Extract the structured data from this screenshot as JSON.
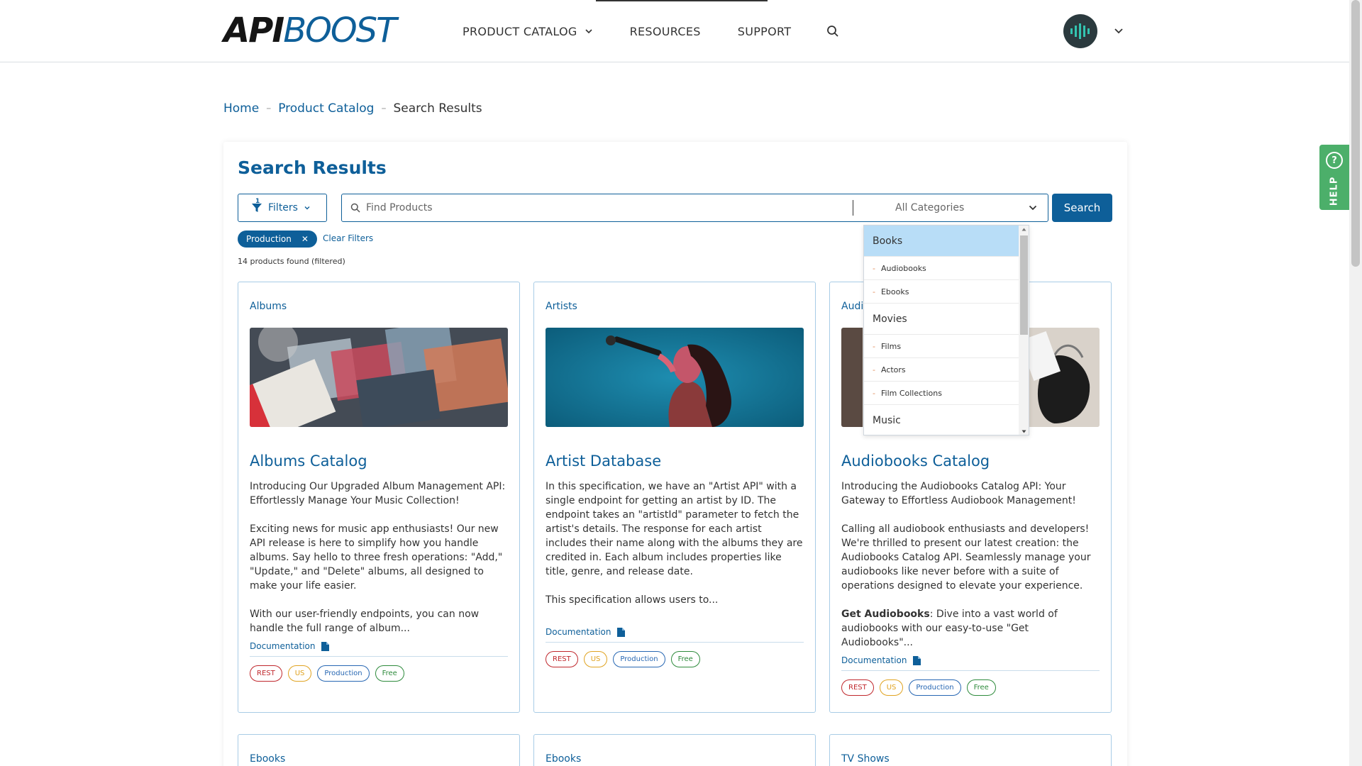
{
  "header": {
    "logo_part1": "API",
    "logo_part2": "BOOST",
    "nav": [
      {
        "label": "PRODUCT CATALOG"
      },
      {
        "label": "RESOURCES"
      },
      {
        "label": "SUPPORT"
      }
    ]
  },
  "help": {
    "label": "HELP",
    "icon": "?"
  },
  "breadcrumb": {
    "home": "Home",
    "catalog": "Product Catalog",
    "current": "Search Results"
  },
  "search": {
    "title": "Search Results",
    "filters_label": "Filters",
    "filter_count": "1",
    "placeholder": "Find Products",
    "category_selected": "All Categories",
    "button": "Search",
    "active_filter": "Production",
    "clear_filters": "Clear Filters",
    "results_text": "14 products found (filtered)"
  },
  "dropdown": {
    "books": "Books",
    "audiobooks": "Audiobooks",
    "ebooks": "Ebooks",
    "movies": "Movies",
    "films": "Films",
    "actors": "Actors",
    "film_collections": "Film Collections",
    "music": "Music",
    "dash": "-"
  },
  "cards": [
    {
      "category": "Albums",
      "title": "Albums Catalog",
      "p1": "Introducing Our Upgraded Album Management API: Effortlessly Manage Your Music Collection!",
      "p2": "Exciting news for music app enthusiasts! Our new API release is here to simplify how you handle albums. Say hello to three fresh operations: \"Add,\" \"Update,\" and \"Delete\" albums, all designed to make your life easier.",
      "p3": "With our user-friendly endpoints, you can now handle the full range of album...",
      "doc": "Documentation",
      "tags": [
        "REST",
        "US",
        "Production",
        "Free"
      ]
    },
    {
      "category": "Artists",
      "title": "Artist Database",
      "p1": "In this specification, we have an \"Artist API\" with a single endpoint for getting an artist by ID. The endpoint takes an \"artistId\" parameter to fetch the artist's details. The response for each artist includes their name along with the albums they are credited in. Each album includes properties like title, genre, and release date.",
      "p2": "This specification allows users to...",
      "doc": "Documentation",
      "tags": [
        "REST",
        "US",
        "Production",
        "Free"
      ]
    },
    {
      "category": "Audi",
      "title": "Audiobooks Catalog",
      "p1": "Introducing the Audiobooks Catalog API: Your Gateway to Effortless Audiobook Management!",
      "p2": "Calling all audiobook enthusiasts and developers! We're thrilled to present our latest creation: the Audiobooks Catalog API. Seamlessly manage your audiobooks like never before with a suite of operations designed to elevate your experience.",
      "p3_bold": "Get Audiobooks",
      "p3": ": Dive into a vast world of audiobooks with our easy-to-use \"Get Audiobooks\"...",
      "doc": "Documentation",
      "tags": [
        "REST",
        "US",
        "Production",
        "Free"
      ]
    },
    {
      "category": "Ebooks"
    },
    {
      "category": "Ebooks"
    },
    {
      "category": "TV Shows"
    }
  ],
  "colors": {
    "brand_blue": "#0e5f99",
    "help_green": "#4caf6a",
    "tag_rest": "#c0282d",
    "tag_us": "#e0a321",
    "tag_production": "#2767b3",
    "tag_free": "#2e8b3c",
    "dropdown_highlight": "#b8ddf7"
  }
}
